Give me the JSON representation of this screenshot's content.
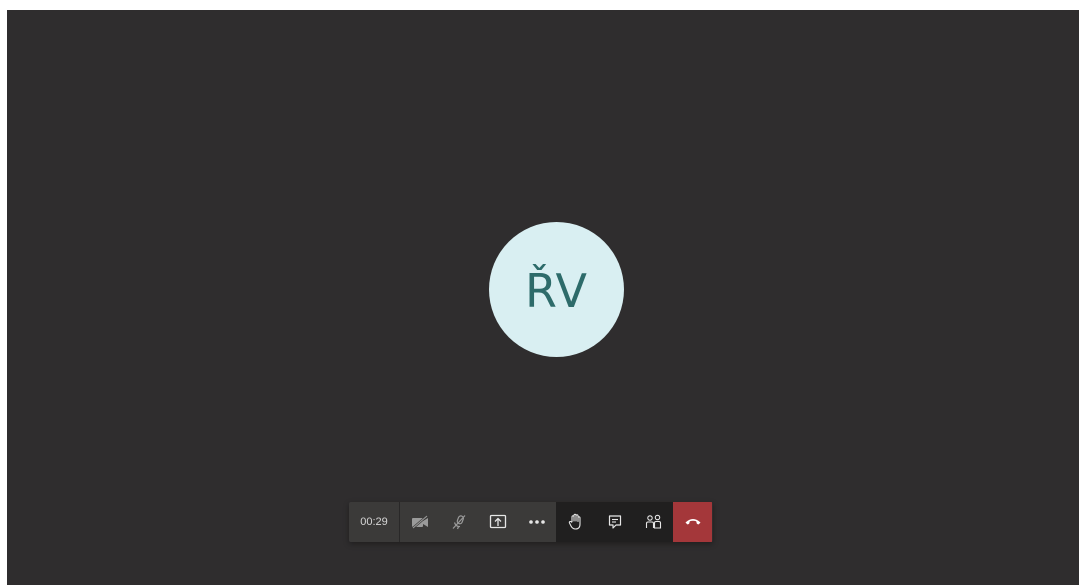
{
  "call": {
    "participant_initials": "ŘV",
    "elapsed_time": "00:29"
  },
  "controls": {
    "items": [
      {
        "name": "camera-off",
        "icon": "video-off-icon"
      },
      {
        "name": "mic-muted",
        "icon": "mic-off-icon"
      },
      {
        "name": "share-screen",
        "icon": "share-screen-icon"
      },
      {
        "name": "more-actions",
        "icon": "ellipsis-icon"
      },
      {
        "name": "raise-hand",
        "icon": "hand-icon"
      },
      {
        "name": "chat",
        "icon": "chat-icon"
      },
      {
        "name": "participants",
        "icon": "people-icon"
      },
      {
        "name": "hang-up",
        "icon": "phone-hangup-icon"
      }
    ]
  },
  "colors": {
    "stage_background": "#2f2d2e",
    "avatar_background": "#d9eff2",
    "avatar_text": "#2d6b6a",
    "toolbar_background": "#3b3a39",
    "toolbar_dark_background": "#201f1f",
    "hangup_background": "#a4373a",
    "icon_color": "#d6d6d6"
  }
}
